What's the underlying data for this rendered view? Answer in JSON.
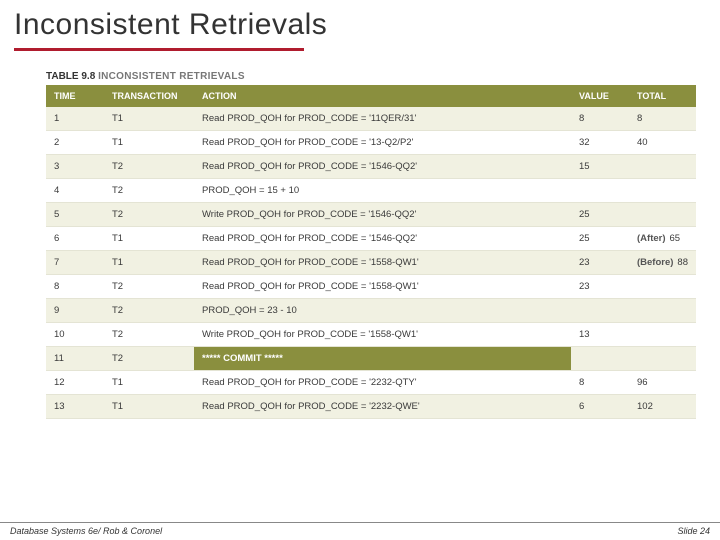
{
  "title": "Inconsistent Retrievals",
  "table": {
    "caption_prefix": "TABLE 9.8",
    "caption_text": "INCONSISTENT RETRIEVALS",
    "headers": {
      "time": "TIME",
      "transaction": "TRANSACTION",
      "action": "ACTION",
      "value": "VALUE",
      "total": "TOTAL"
    },
    "rows": [
      {
        "time": "1",
        "transaction": "T1",
        "action": "Read PROD_QOH for PROD_CODE = '11QER/31'",
        "value": "8",
        "total_note": "",
        "total": "8",
        "commit": false
      },
      {
        "time": "2",
        "transaction": "T1",
        "action": "Read PROD_QOH for PROD_CODE = '13-Q2/P2'",
        "value": "32",
        "total_note": "",
        "total": "40",
        "commit": false
      },
      {
        "time": "3",
        "transaction": "T2",
        "action": "Read PROD_QOH for PROD_CODE = '1546-QQ2'",
        "value": "15",
        "total_note": "",
        "total": "",
        "commit": false
      },
      {
        "time": "4",
        "transaction": "T2",
        "action": "PROD_QOH = 15 + 10",
        "value": "",
        "total_note": "",
        "total": "",
        "commit": false
      },
      {
        "time": "5",
        "transaction": "T2",
        "action": "Write PROD_QOH for PROD_CODE = '1546-QQ2'",
        "value": "25",
        "total_note": "",
        "total": "",
        "commit": false
      },
      {
        "time": "6",
        "transaction": "T1",
        "action": "Read PROD_QOH for PROD_CODE = '1546-QQ2'",
        "value": "25",
        "total_note": "(After)",
        "total": "65",
        "commit": false
      },
      {
        "time": "7",
        "transaction": "T1",
        "action": "Read PROD_QOH for PROD_CODE = '1558-QW1'",
        "value": "23",
        "total_note": "(Before)",
        "total": "88",
        "commit": false
      },
      {
        "time": "8",
        "transaction": "T2",
        "action": "Read PROD_QOH for PROD_CODE = '1558-QW1'",
        "value": "23",
        "total_note": "",
        "total": "",
        "commit": false
      },
      {
        "time": "9",
        "transaction": "T2",
        "action": "PROD_QOH = 23 - 10",
        "value": "",
        "total_note": "",
        "total": "",
        "commit": false
      },
      {
        "time": "10",
        "transaction": "T2",
        "action": "Write PROD_QOH for PROD_CODE = '1558-QW1'",
        "value": "13",
        "total_note": "",
        "total": "",
        "commit": false
      },
      {
        "time": "11",
        "transaction": "T2",
        "action": "***** COMMIT *****",
        "value": "",
        "total_note": "",
        "total": "",
        "commit": true
      },
      {
        "time": "12",
        "transaction": "T1",
        "action": "Read PROD_QOH for PROD_CODE = '2232-QTY'",
        "value": "8",
        "total_note": "",
        "total": "96",
        "commit": false
      },
      {
        "time": "13",
        "transaction": "T1",
        "action": "Read PROD_QOH for PROD_CODE = '2232-QWE'",
        "value": "6",
        "total_note": "",
        "total": "102",
        "commit": false
      }
    ]
  },
  "footer": {
    "left": "Database Systems 6e/ Rob & Coronel",
    "right": "Slide 24"
  }
}
